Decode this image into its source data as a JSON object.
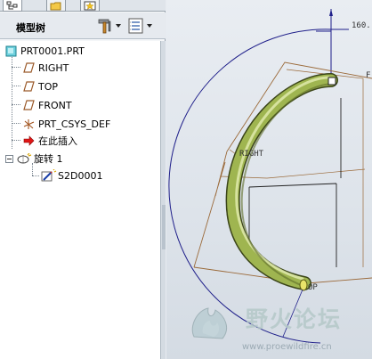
{
  "tree_panel": {
    "title": "模型树",
    "tabs": [
      "model-tree-tab",
      "folder-tab",
      "favorites-tab"
    ]
  },
  "tree": {
    "root": "PRT0001.PRT",
    "items": [
      {
        "label": "RIGHT",
        "icon": "datum-plane-icon"
      },
      {
        "label": "TOP",
        "icon": "datum-plane-icon"
      },
      {
        "label": "FRONT",
        "icon": "datum-plane-icon"
      },
      {
        "label": "PRT_CSYS_DEF",
        "icon": "csys-icon"
      },
      {
        "label": "在此插入",
        "icon": "insert-here-arrow-icon"
      }
    ],
    "feature": {
      "label": "旋转 1",
      "icon": "revolve-icon"
    },
    "sketch": {
      "label": "S2D0001",
      "icon": "sketch-icon"
    }
  },
  "viewport": {
    "dim_label": "160.",
    "plane_right": "RIGHT",
    "plane_top": "OP",
    "plane_f": "F"
  },
  "watermark": {
    "title": "野火论坛",
    "url": "www.proewildfire.cn"
  },
  "colors": {
    "accent_blue": "#1f1f8a",
    "plane_edge": "#9b6a3a",
    "tube": "#8fa847"
  }
}
